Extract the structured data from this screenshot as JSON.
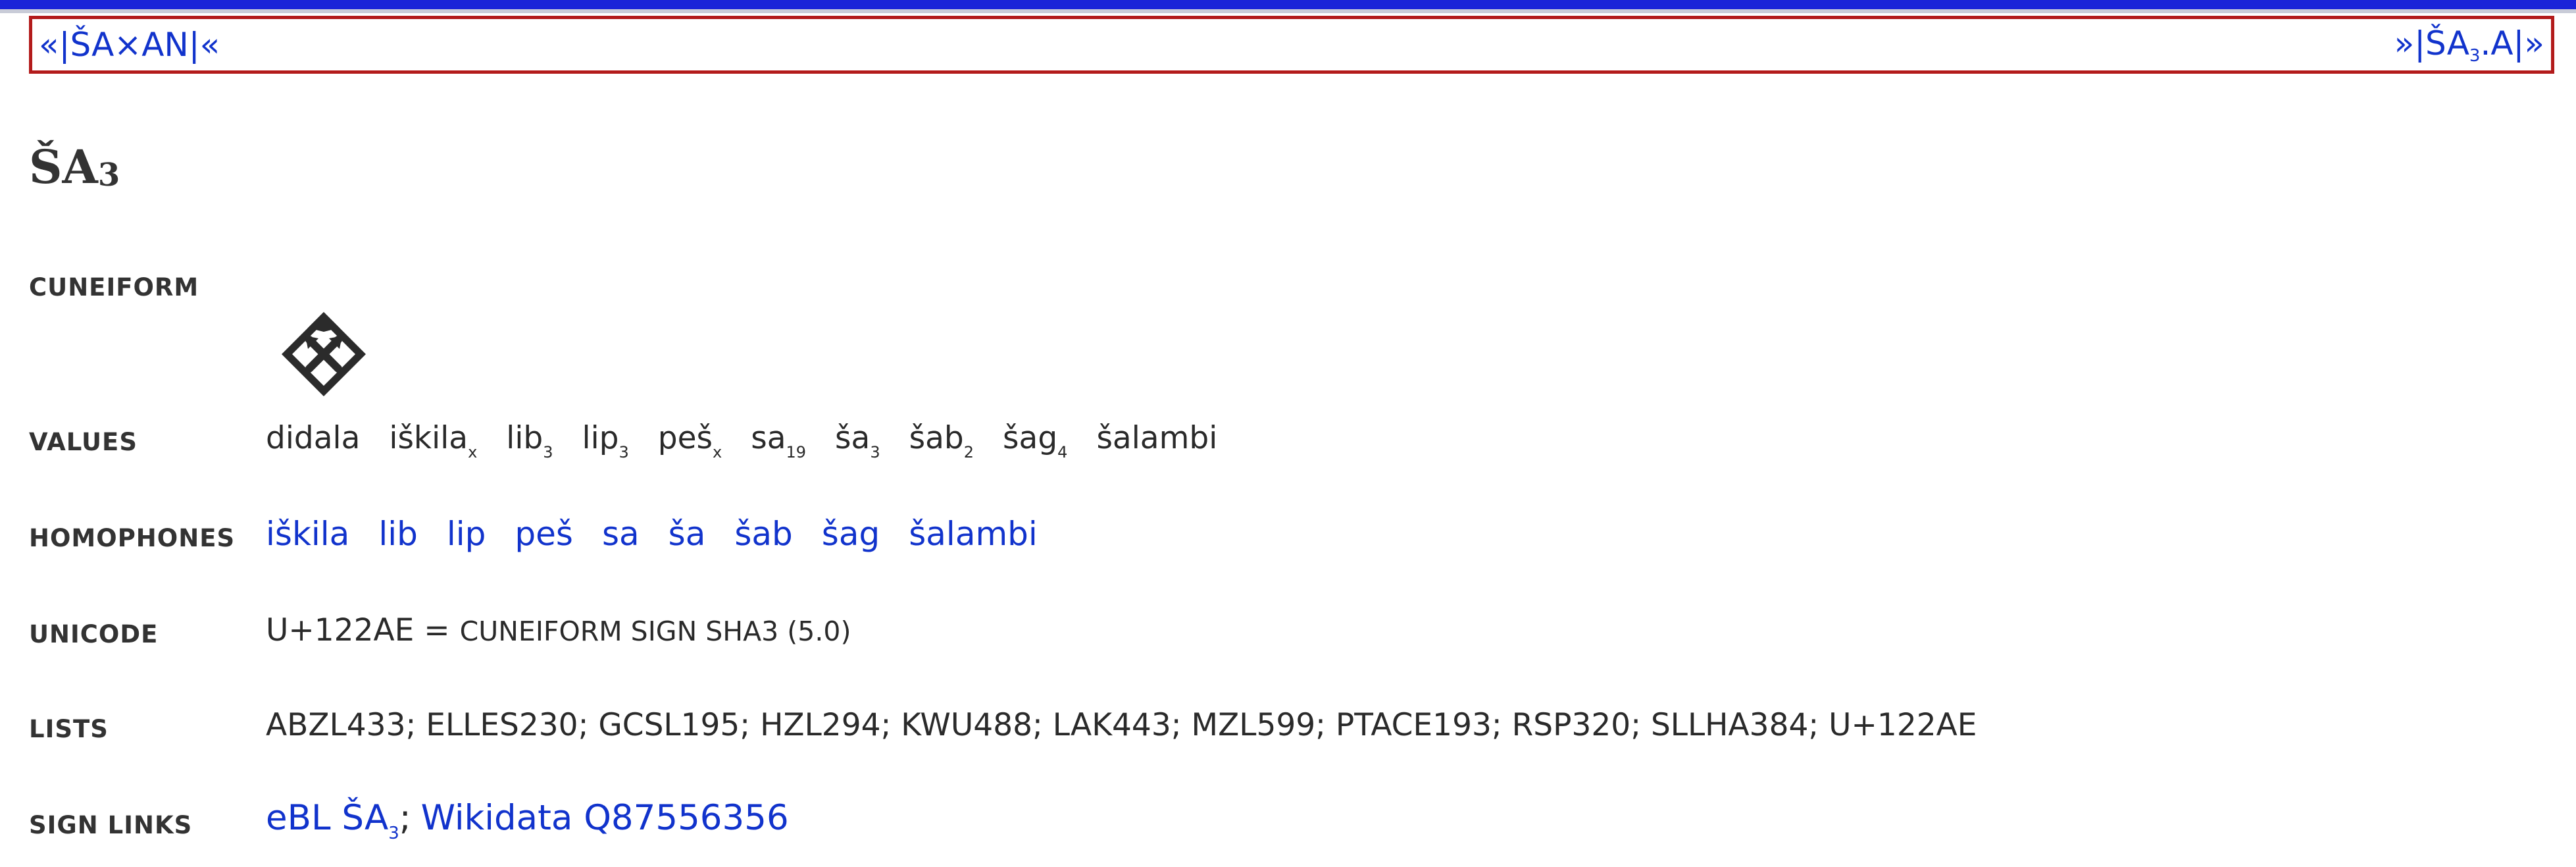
{
  "nav": {
    "prev_open": "«",
    "prev_label": "|ŠA×AN|",
    "prev_close": "«",
    "next_open": "»",
    "next_label_pre": "|ŠA",
    "next_label_sub": "3",
    "next_label_post": ".A|",
    "next_close": "»"
  },
  "title": {
    "main": "ŠA",
    "sub": "3"
  },
  "labels": {
    "cuneiform": "CUNEIFORM",
    "values": "VALUES",
    "homophones": "HOMOPHONES",
    "unicode": "UNICODE",
    "lists": "LISTS",
    "sign_links": "SIGN LINKS"
  },
  "values": [
    {
      "text": "didala",
      "sub": ""
    },
    {
      "text": "iškila",
      "sub": "x"
    },
    {
      "text": "lib",
      "sub": "3"
    },
    {
      "text": "lip",
      "sub": "3"
    },
    {
      "text": "peš",
      "sub": "x"
    },
    {
      "text": "sa",
      "sub": "19"
    },
    {
      "text": "ša",
      "sub": "3"
    },
    {
      "text": "šab",
      "sub": "2"
    },
    {
      "text": "šag",
      "sub": "4"
    },
    {
      "text": "šalambi",
      "sub": ""
    }
  ],
  "homophones": [
    "iškila",
    "lib",
    "lip",
    "peš",
    "sa",
    "ša",
    "šab",
    "šag",
    "šalambi"
  ],
  "unicode": {
    "code": "U+122AE =",
    "name": "CUNEIFORM SIGN SHA3 (5.0)"
  },
  "lists": "ABZL433; ELLES230; GCSL195; HZL294; KWU488; LAK443; MZL599; PTACE193; RSP320; SLLHA384; U+122AE",
  "sign_links": {
    "ebl_pre": "eBL ŠA",
    "ebl_sub": "3",
    "separator": ";",
    "wikidata": "Wikidata Q87556356"
  },
  "colors": {
    "link": "#1133cc",
    "nav_border": "#b31b1b",
    "top_bar": "#1a23d8"
  },
  "icons": {
    "cuneiform": "cuneiform-sha3-glyph"
  }
}
